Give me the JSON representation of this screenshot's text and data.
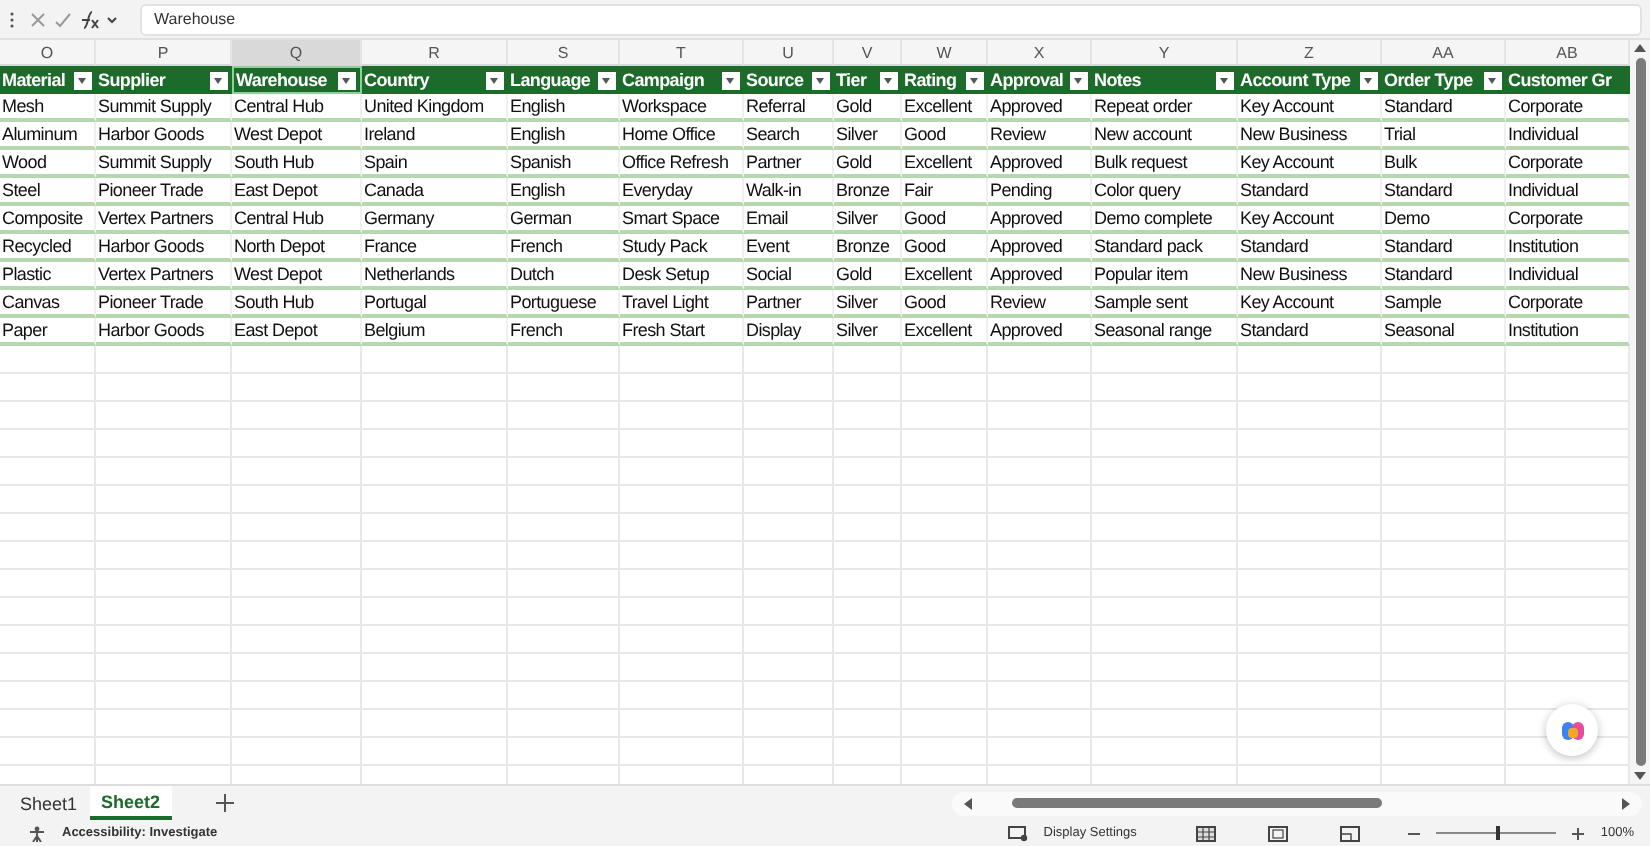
{
  "formula_bar": {
    "value": "Warehouse"
  },
  "columns": [
    {
      "letter": "O",
      "header": "Material",
      "selected": false
    },
    {
      "letter": "P",
      "header": "Supplier",
      "selected": false
    },
    {
      "letter": "Q",
      "header": "Warehouse",
      "selected": true
    },
    {
      "letter": "R",
      "header": "Country",
      "selected": false
    },
    {
      "letter": "S",
      "header": "Language",
      "selected": false
    },
    {
      "letter": "T",
      "header": "Campaign",
      "selected": false
    },
    {
      "letter": "U",
      "header": "Source",
      "selected": false
    },
    {
      "letter": "V",
      "header": "Tier",
      "selected": false
    },
    {
      "letter": "W",
      "header": "Rating",
      "selected": false
    },
    {
      "letter": "X",
      "header": "Approval",
      "selected": false
    },
    {
      "letter": "Y",
      "header": "Notes",
      "selected": false
    },
    {
      "letter": "Z",
      "header": "Account Type",
      "selected": false
    },
    {
      "letter": "AA",
      "header": "Order Type",
      "selected": false
    },
    {
      "letter": "AB",
      "header": "Customer Gr",
      "selected": false
    }
  ],
  "rows": [
    [
      "Mesh",
      "Summit Supply",
      "Central Hub",
      "United Kingdom",
      "English",
      "Workspace",
      "Referral",
      "Gold",
      "Excellent",
      "Approved",
      "Repeat order",
      "Key Account",
      "Standard",
      "Corporate"
    ],
    [
      "Aluminum",
      "Harbor Goods",
      "West Depot",
      "Ireland",
      "English",
      "Home Office",
      "Search",
      "Silver",
      "Good",
      "Review",
      "New account",
      "New Business",
      "Trial",
      "Individual"
    ],
    [
      "Wood",
      "Summit Supply",
      "South Hub",
      "Spain",
      "Spanish",
      "Office Refresh",
      "Partner",
      "Gold",
      "Excellent",
      "Approved",
      "Bulk request",
      "Key Account",
      "Bulk",
      "Corporate"
    ],
    [
      "Steel",
      "Pioneer Trade",
      "East Depot",
      "Canada",
      "English",
      "Everyday",
      "Walk-in",
      "Bronze",
      "Fair",
      "Pending",
      "Color query",
      "Standard",
      "Standard",
      "Individual"
    ],
    [
      "Composite",
      "Vertex Partners",
      "Central Hub",
      "Germany",
      "German",
      "Smart Space",
      "Email",
      "Silver",
      "Good",
      "Approved",
      "Demo complete",
      "Key Account",
      "Demo",
      "Corporate"
    ],
    [
      "Recycled",
      "Harbor Goods",
      "North Depot",
      "France",
      "French",
      "Study Pack",
      "Event",
      "Bronze",
      "Good",
      "Approved",
      "Standard pack",
      "Standard",
      "Standard",
      "Institution"
    ],
    [
      "Plastic",
      "Vertex Partners",
      "West Depot",
      "Netherlands",
      "Dutch",
      "Desk Setup",
      "Social",
      "Gold",
      "Excellent",
      "Approved",
      "Popular item",
      "New Business",
      "Standard",
      "Individual"
    ],
    [
      "Canvas",
      "Pioneer Trade",
      "South Hub",
      "Portugal",
      "Portuguese",
      "Travel Light",
      "Partner",
      "Silver",
      "Good",
      "Review",
      "Sample sent",
      "Key Account",
      "Sample",
      "Corporate"
    ],
    [
      "Paper",
      "Harbor Goods",
      "East Depot",
      "Belgium",
      "French",
      "Fresh Start",
      "Display",
      "Silver",
      "Excellent",
      "Approved",
      "Seasonal range",
      "Standard",
      "Seasonal",
      "Institution"
    ]
  ],
  "sheet_tabs": [
    {
      "label": "Sheet1",
      "selected": false
    },
    {
      "label": "Sheet2",
      "selected": true
    }
  ],
  "status_bar": {
    "accessibility": "Accessibility: Investigate",
    "display_settings": "Display Settings",
    "zoom": {
      "level": 0.5,
      "label": "100%"
    }
  }
}
